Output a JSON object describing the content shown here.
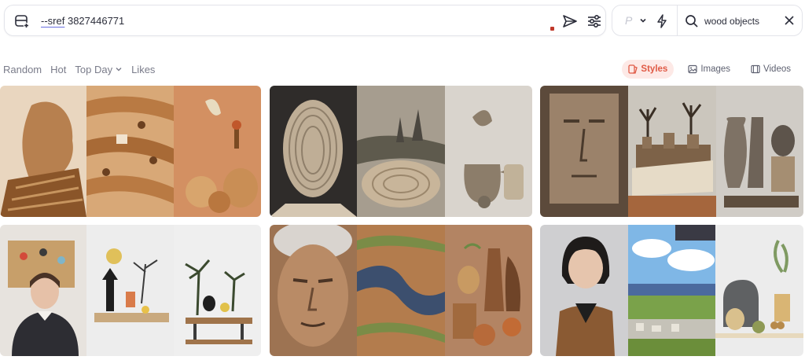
{
  "prompt": {
    "sref_label": "--sref",
    "sref_code": "3827446771"
  },
  "search": {
    "p_label": "P",
    "query": "wood objects"
  },
  "filters": {
    "items": [
      "Random",
      "Hot",
      "Top Day",
      "Likes"
    ]
  },
  "type_tabs": {
    "styles": "Styles",
    "images": "Images",
    "videos": "Videos"
  },
  "colors": {
    "accent": "#e05a45",
    "accent_bg": "#fde9e6",
    "text": "#2b2d3a",
    "muted": "#7a7c8a"
  },
  "icons": [
    "add-prompt-icon",
    "send-icon",
    "sliders-icon",
    "chevron-down-icon",
    "bolt-icon",
    "search-icon",
    "close-icon",
    "styles-icon",
    "image-icon",
    "video-icon"
  ]
}
